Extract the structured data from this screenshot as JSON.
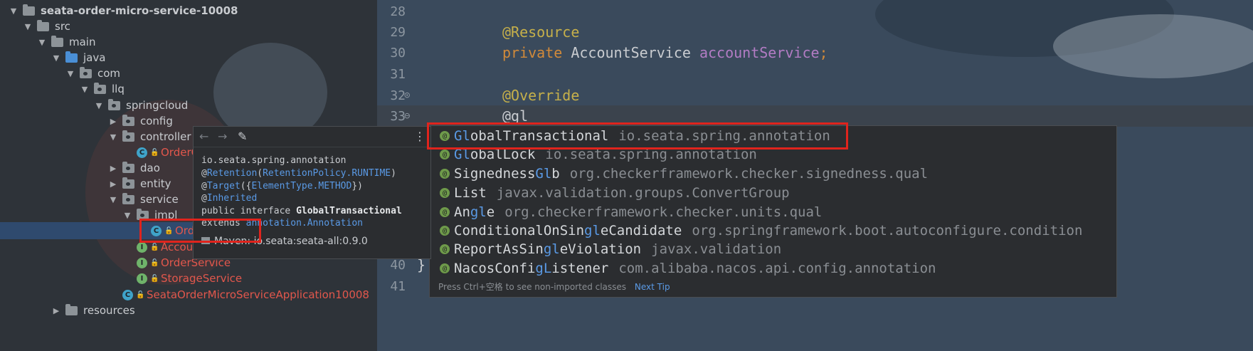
{
  "tree": {
    "root": "seata-order-micro-service-10008",
    "items": [
      {
        "label": "seata-order-micro-service-10008"
      },
      {
        "label": "src"
      },
      {
        "label": "main"
      },
      {
        "label": "java"
      },
      {
        "label": "com"
      },
      {
        "label": "llq"
      },
      {
        "label": "springcloud"
      },
      {
        "label": "config"
      },
      {
        "label": "controller"
      },
      {
        "label": "OrderC"
      },
      {
        "label": "dao"
      },
      {
        "label": "entity"
      },
      {
        "label": "service"
      },
      {
        "label": "impl"
      },
      {
        "label": "Ord"
      },
      {
        "label": "Accour"
      },
      {
        "label": "OrderService"
      },
      {
        "label": "StorageService"
      },
      {
        "label": "SeataOrderMicroServiceApplication10008"
      },
      {
        "label": "resources"
      }
    ]
  },
  "editor": {
    "lines": [
      {
        "num": "28",
        "text": ""
      },
      {
        "num": "29",
        "annotation": "@Resource"
      },
      {
        "num": "30",
        "kw": "private",
        "type": " AccountService ",
        "field": "accountService",
        "semi": ";"
      },
      {
        "num": "31",
        "text": ""
      },
      {
        "num": "32",
        "annotation": "@Override"
      },
      {
        "num": "33",
        "text": "@gl"
      },
      {
        "num": "40",
        "text": "}"
      },
      {
        "num": "41",
        "text": ""
      }
    ]
  },
  "completion": {
    "items": [
      {
        "pre": "",
        "match": "Gl",
        "post": "obalTransactional",
        "pkg": "io.seata.spring.annotation"
      },
      {
        "pre": "",
        "match": "Gl",
        "post": "obalLock",
        "pkg": "io.seata.spring.annotation"
      },
      {
        "pre": "Signedness",
        "match": "Gl",
        "post": "b",
        "pkg": "org.checkerframework.checker.signedness.qual"
      },
      {
        "pre": "Lis",
        "match": "",
        "post": "t",
        "pkg": "javax.validation.groups.ConvertGroup"
      },
      {
        "pre": "An",
        "match": "gl",
        "post": "e",
        "pkg": "org.checkerframework.checker.units.qual"
      },
      {
        "pre": "ConditionalOnSin",
        "match": "gl",
        "post": "eCandidate",
        "pkg": "org.springframework.boot.autoconfigure.condition"
      },
      {
        "pre": "ReportAsSin",
        "match": "gl",
        "post": "eViolation",
        "pkg": "javax.validation"
      },
      {
        "pre": "NacosConfi",
        "match": "gL",
        "post": "istener",
        "pkg": "com.alibaba.nacos.api.config.annotation"
      }
    ],
    "tip": "Press Ctrl+空格 to see non-imported classes",
    "tip_link": "Next Tip"
  },
  "doc": {
    "package": "io.seata.spring.annotation",
    "retention_pre": "@",
    "retention": "Retention",
    "retention_arg": "RetentionPolicy.RUNTIME",
    "target": "Target",
    "target_arg": "ElementType.METHOD",
    "inherited": "Inherited",
    "decl": "public interface ",
    "decl_name": "GlobalTransactional",
    "extends_kw": "extends ",
    "extends_type": "annotation.Annotation",
    "maven": "Maven: io.seata:seata-all:0.9.0"
  }
}
